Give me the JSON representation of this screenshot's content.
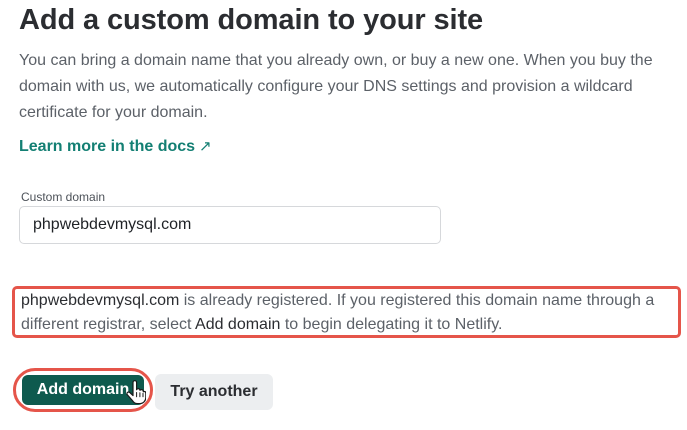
{
  "header": {
    "title": "Add a custom domain to your site"
  },
  "intro": {
    "text": "You can bring a domain name that you already own, or buy a new one. When you buy the domain with us, we automatically configure your DNS settings and provision a wildcard certificate for your domain."
  },
  "docs_link": {
    "label": "Learn more in the docs",
    "arrow": "↗"
  },
  "domain_field": {
    "label": "Custom domain",
    "value": "phpwebdevmysql.com"
  },
  "notice": {
    "domain": "phpwebdevmysql.com",
    "text_before": " is already registered. If you registered this domain name through a different registrar, select ",
    "action": "Add domain",
    "text_after": " to begin delegating it to Netlify."
  },
  "actions": {
    "add_label": "Add domain",
    "try_label": "Try another"
  },
  "colors": {
    "accent": "#137f73",
    "primary_button": "#0e5a4e",
    "highlight": "#e5554a"
  },
  "icons": {
    "external_link": "arrow-up-right-icon",
    "cursor": "hand-pointer-icon"
  }
}
